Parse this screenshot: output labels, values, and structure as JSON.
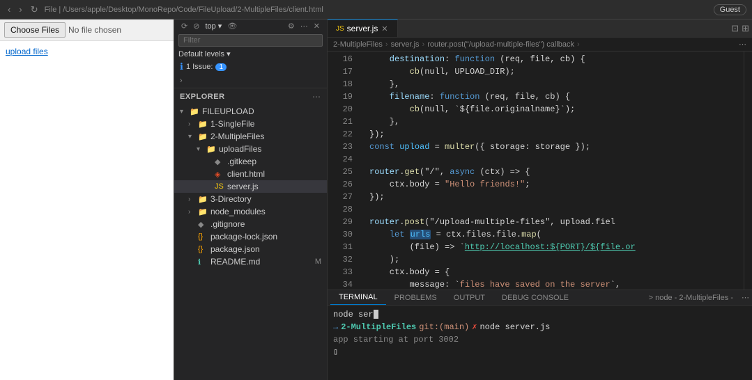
{
  "topbar": {
    "back_btn": "‹",
    "forward_btn": "›",
    "reload_btn": "↻",
    "file_path": "File | /Users/apple/Desktop/MonoRepo/Code/FileUpload/2-MultipleFiles/client.html",
    "guest_label": "Guest"
  },
  "browser": {
    "choose_files_label": "Choose Files",
    "no_file_label": "No file chosen",
    "upload_link_label": "upload files"
  },
  "problems_panel": {
    "toolbar_btns": [
      "⟳",
      "⊘",
      "top ▾",
      "👁"
    ],
    "settings_icon": "⚙",
    "more_icon": "⋯",
    "filter_placeholder": "Filter",
    "levels_label": "Default levels ▾",
    "issue_label": "1 Issue:",
    "issue_badge": "1",
    "arrow": "›"
  },
  "explorer": {
    "title": "EXPLORER",
    "more_icon": "⋯",
    "root": {
      "name": "FILEUPLOAD",
      "expanded": true
    },
    "items": [
      {
        "id": "1-SingleFile",
        "label": "1-SingleFile",
        "type": "folder",
        "indent": 1,
        "expanded": false
      },
      {
        "id": "2-MultipleFiles",
        "label": "2-MultipleFiles",
        "type": "folder",
        "indent": 1,
        "expanded": true
      },
      {
        "id": "uploadFiles",
        "label": "uploadFiles",
        "type": "folder",
        "indent": 2,
        "expanded": true
      },
      {
        "id": ".gitkeep",
        "label": ".gitkeep",
        "type": "gitkeep",
        "indent": 3
      },
      {
        "id": "client.html",
        "label": "client.html",
        "type": "html",
        "indent": 3
      },
      {
        "id": "server.js",
        "label": "server.js",
        "type": "js",
        "indent": 3,
        "active": true
      },
      {
        "id": "3-Directory",
        "label": "3-Directory",
        "type": "folder",
        "indent": 1,
        "expanded": false
      },
      {
        "id": "node_modules",
        "label": "node_modules",
        "type": "folder",
        "indent": 1,
        "expanded": false
      },
      {
        "id": ".gitignore",
        "label": ".gitignore",
        "type": "gitignore",
        "indent": 1
      },
      {
        "id": "package-lock.json",
        "label": "package-lock.json",
        "type": "json",
        "indent": 1
      },
      {
        "id": "package.json",
        "label": "package.json",
        "type": "json",
        "indent": 1
      },
      {
        "id": "README.md",
        "label": "README.md",
        "type": "readme",
        "indent": 1,
        "badge": "M"
      }
    ]
  },
  "editor": {
    "tab_label": "server.js",
    "tab_icon": "JS",
    "breadcrumb": [
      "2-MultipleFiles",
      "server.js",
      "router.post(\"/upload-multiple-files\") callback"
    ],
    "lines": [
      {
        "num": 16,
        "tokens": [
          {
            "t": "    destination: ",
            "c": "prop"
          },
          {
            "t": "function",
            "c": "kw"
          },
          {
            "t": " (req, file, cb) {",
            "c": "op"
          }
        ]
      },
      {
        "num": 17,
        "tokens": [
          {
            "t": "        cb(null, UPLOAD_DIR);",
            "c": "op"
          }
        ]
      },
      {
        "num": 18,
        "tokens": [
          {
            "t": "    },",
            "c": "op"
          }
        ]
      },
      {
        "num": 19,
        "tokens": [
          {
            "t": "    filename: ",
            "c": "prop"
          },
          {
            "t": "function",
            "c": "kw"
          },
          {
            "t": " (req, file, cb) {",
            "c": "op"
          }
        ]
      },
      {
        "num": 20,
        "tokens": [
          {
            "t": "        cb(null, `${file.originalname}`);",
            "c": "op"
          }
        ]
      },
      {
        "num": 21,
        "tokens": [
          {
            "t": "    },",
            "c": "op"
          }
        ]
      },
      {
        "num": 22,
        "tokens": [
          {
            "t": "});",
            "c": "op"
          }
        ]
      },
      {
        "num": 23,
        "tokens": [
          {
            "t": "const ",
            "c": "kw"
          },
          {
            "t": "upload",
            "c": "var"
          },
          {
            "t": " = ",
            "c": "op"
          },
          {
            "t": "multer",
            "c": "fn"
          },
          {
            "t": "({ storage: storage });",
            "c": "op"
          }
        ]
      },
      {
        "num": 24,
        "tokens": [
          {
            "t": "",
            "c": "op"
          }
        ]
      },
      {
        "num": 25,
        "tokens": [
          {
            "t": "router.",
            "c": "prop"
          },
          {
            "t": "get",
            "c": "fn"
          },
          {
            "t": "(\"/\", ",
            "c": "op"
          },
          {
            "t": "async",
            "c": "kw"
          },
          {
            "t": " (ctx) => {",
            "c": "op"
          }
        ]
      },
      {
        "num": 26,
        "tokens": [
          {
            "t": "    ctx.body = ",
            "c": "op"
          },
          {
            "t": "\"Hello friends!\";",
            "c": "str"
          }
        ]
      },
      {
        "num": 27,
        "tokens": [
          {
            "t": "});",
            "c": "op"
          }
        ]
      },
      {
        "num": 28,
        "tokens": [
          {
            "t": "",
            "c": "op"
          }
        ]
      },
      {
        "num": 29,
        "tokens": [
          {
            "t": "router.",
            "c": "prop"
          },
          {
            "t": "post",
            "c": "fn"
          },
          {
            "t": "(\"/upload-multiple-files\", upload.fiel...",
            "c": "op"
          }
        ]
      },
      {
        "num": 30,
        "tokens": [
          {
            "t": "    ",
            "c": "op"
          },
          {
            "t": "let",
            "c": "kw"
          },
          {
            "t": " ",
            "c": "op"
          },
          {
            "t": "urls",
            "c": "var"
          },
          {
            "t": " = ctx.files.file.",
            "c": "op"
          },
          {
            "t": "map",
            "c": "fn"
          },
          {
            "t": "(",
            "c": "op"
          }
        ]
      },
      {
        "num": 31,
        "tokens": [
          {
            "t": "        (file) => `",
            "c": "op"
          },
          {
            "t": "http://localhost:${PORT}/${file.or...",
            "c": "url-link"
          }
        ]
      },
      {
        "num": 32,
        "tokens": [
          {
            "t": "    );",
            "c": "op"
          }
        ]
      },
      {
        "num": 33,
        "tokens": [
          {
            "t": "    ctx.body = {",
            "c": "op"
          }
        ]
      },
      {
        "num": 34,
        "tokens": [
          {
            "t": "        message: `",
            "c": "op"
          },
          {
            "t": "files have saved on the server",
            "c": "str"
          },
          {
            "t": "`,",
            "c": "op"
          }
        ]
      }
    ]
  },
  "terminal": {
    "tabs": [
      "TERMINAL",
      "PROBLEMS",
      "OUTPUT",
      "DEBUG CONSOLE"
    ],
    "active_tab": "TERMINAL",
    "instance_label": "> node - 2-MultipleFiles -",
    "lines": [
      {
        "type": "cmd",
        "text": "node ser"
      },
      {
        "type": "prompt",
        "path": "2-MultipleFiles",
        "branch": "git:(main)",
        "marker": "✗",
        "cmd": "node server.js"
      },
      {
        "type": "output",
        "text": "app starting at port 3002"
      },
      {
        "type": "cursor"
      }
    ]
  }
}
